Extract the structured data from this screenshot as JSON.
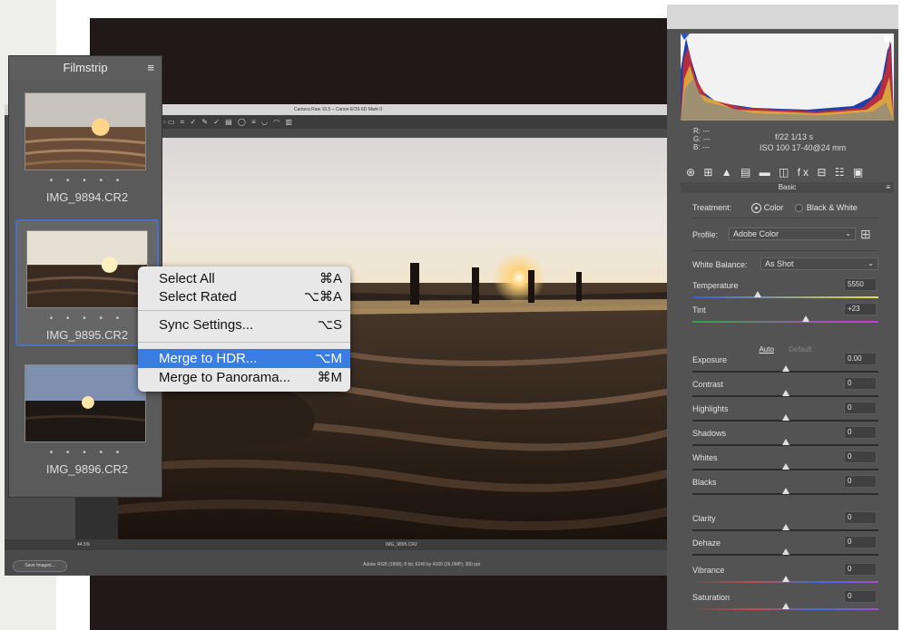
{
  "raw_window": {
    "title": "Camera Raw 10.5  –  Canon EOS 6D Mark II",
    "toolbar_icons": "◦▭ ⌗ ✓ ✎ ✓ ▤ ◯ ≡ ◡ ◠ ▥",
    "zoom": "44.5%",
    "status_filename": "IMG_9895.CR2",
    "save_button": "Save Images...",
    "workflow_info": "Adobe RGB (1998); 8 bit; 6240 by 4160 (26.0MP); 300 ppi"
  },
  "filmstrip": {
    "title": "Filmstrip",
    "menu_icon": "≡",
    "items": [
      {
        "name": "IMG_9894.CR2",
        "rating": "• • • • •"
      },
      {
        "name": "IMG_9895.CR2",
        "rating": "• • • • •"
      },
      {
        "name": "IMG_9896.CR2",
        "rating": "• • • • •"
      }
    ]
  },
  "context_menu": {
    "items": [
      {
        "label": "Select All",
        "shortcut": "⌘A"
      },
      {
        "label": "Select Rated",
        "shortcut": "⌥⌘A"
      },
      {
        "label": "Sync Settings...",
        "shortcut": "⌥S"
      },
      {
        "label": "Merge to HDR...",
        "shortcut": "⌥M"
      },
      {
        "label": "Merge to Panorama...",
        "shortcut": "⌘M"
      }
    ]
  },
  "right_panel": {
    "rgb_readout": {
      "r": "R:  ---",
      "g": "G:  ---",
      "b": "B:  ---"
    },
    "exif_line1": "f/22   1/13 s",
    "exif_line2": "ISO 100   17-40@24 mm",
    "tab_icons": "⊛ ⊞ ▲ ▤ ▬ ◫ fx ⊟ ☷ ▣",
    "panel_title": "Basic",
    "panel_menu": "≡",
    "treatment_label": "Treatment:",
    "treatment_color": "Color",
    "treatment_bw": "Black & White",
    "profile_label": "Profile:",
    "profile_value": "Adobe Color",
    "profile_grid_icon": "⊞",
    "wb_label": "White Balance:",
    "wb_value": "As Shot",
    "auto_label": "Auto",
    "default_label": "Default",
    "sliders": [
      {
        "label": "Temperature",
        "value": "5550",
        "position": 0.35
      },
      {
        "label": "Tint",
        "value": "+23",
        "position": 0.61
      },
      {
        "label": "Exposure",
        "value": "0.00",
        "position": 0.5
      },
      {
        "label": "Contrast",
        "value": "0",
        "position": 0.5
      },
      {
        "label": "Highlights",
        "value": "0",
        "position": 0.5
      },
      {
        "label": "Shadows",
        "value": "0",
        "position": 0.5
      },
      {
        "label": "Whites",
        "value": "0",
        "position": 0.5
      },
      {
        "label": "Blacks",
        "value": "0",
        "position": 0.5
      },
      {
        "label": "Clarity",
        "value": "0",
        "position": 0.5
      },
      {
        "label": "Dehaze",
        "value": "0",
        "position": 0.5
      },
      {
        "label": "Vibrance",
        "value": "0",
        "position": 0.5
      },
      {
        "label": "Saturation",
        "value": "0",
        "position": 0.5
      }
    ]
  },
  "colors": {
    "selection_blue": "#3a7ce0",
    "filmstrip_selected_border": "#4b6fc2",
    "backdrop": "#211919"
  }
}
